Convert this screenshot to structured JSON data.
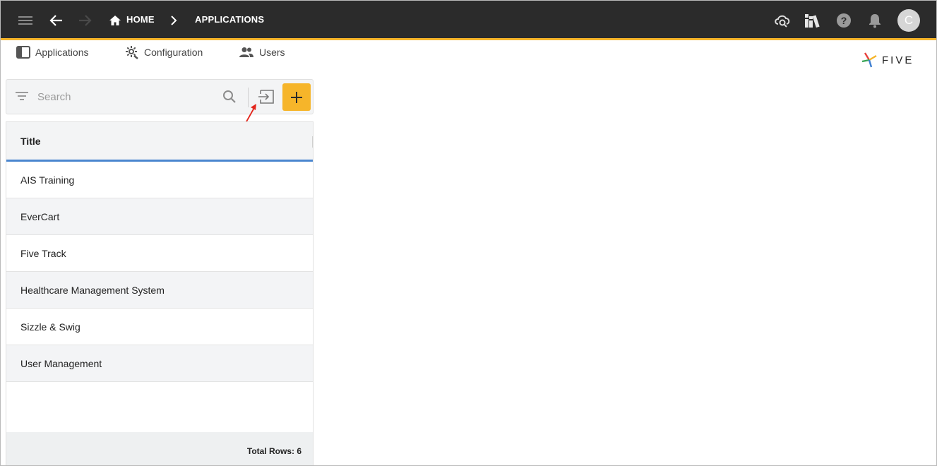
{
  "header": {
    "breadcrumb": [
      {
        "label": "HOME",
        "icon": "home-icon"
      },
      {
        "label": "APPLICATIONS"
      }
    ],
    "avatar_initial": "C",
    "colors": {
      "bar": "#2b2b2b",
      "accent": "#f6b52a"
    }
  },
  "tabs": [
    {
      "label": "Applications",
      "icon": "applications-icon"
    },
    {
      "label": "Configuration",
      "icon": "configuration-gear-icon"
    },
    {
      "label": "Users",
      "icon": "users-icon"
    }
  ],
  "brand": {
    "name": "FIVE"
  },
  "search": {
    "placeholder": "Search",
    "value": ""
  },
  "table": {
    "columns": [
      "Title"
    ],
    "rows": [
      "AIS Training",
      "EverCart",
      "Five Track",
      "Healthcare Management System",
      "Sizzle & Swig",
      "User Management"
    ],
    "footer": "Total Rows: 6"
  }
}
